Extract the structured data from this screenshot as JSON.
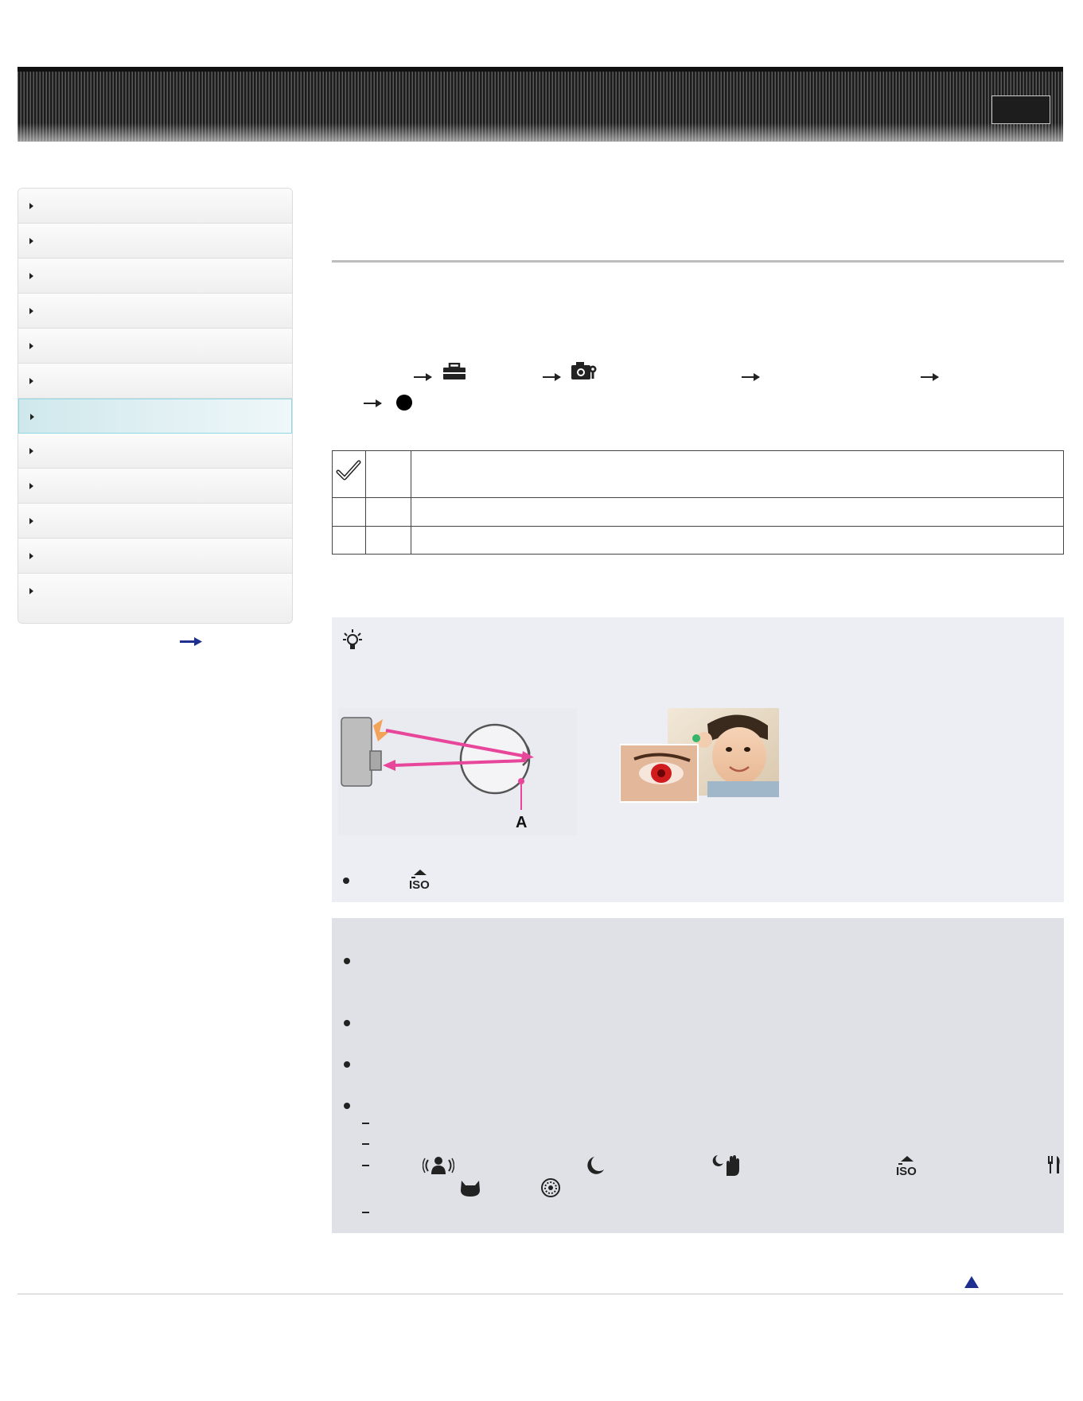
{
  "header": {
    "title": "",
    "top_button_label": ""
  },
  "sidebar": {
    "items": [
      {
        "label": ""
      },
      {
        "label": ""
      },
      {
        "label": ""
      },
      {
        "label": ""
      },
      {
        "label": ""
      },
      {
        "label": ""
      },
      {
        "label": "",
        "active": true
      },
      {
        "label": ""
      },
      {
        "label": ""
      },
      {
        "label": ""
      },
      {
        "label": ""
      },
      {
        "label": ""
      }
    ],
    "more_link_label": ""
  },
  "page": {
    "title": "",
    "intro": "",
    "menu_path_icons": [
      "toolbox-icon",
      "camera-settings-icon",
      "record-dot-icon"
    ]
  },
  "settings_table": {
    "rows": [
      {
        "icon": "checkmark-icon",
        "name": "",
        "description": ""
      },
      {
        "icon": "",
        "name": "",
        "description": ""
      },
      {
        "icon": "",
        "name": "",
        "description": ""
      }
    ]
  },
  "hint": {
    "icon": "lightbulb-icon",
    "title": "",
    "diagram_label": "A",
    "bullet_icon": "high-sensitivity-iso-icon"
  },
  "notes": {
    "title": "",
    "scene_icons": [
      "anti-blur-icon",
      "twilight-icon",
      "hand-held-twilight-icon",
      "high-sensitivity-iso-icon",
      "gourmet-icon",
      "pet-icon",
      "sports-icon"
    ]
  },
  "colors": {
    "header_dark": "#1c1c1c",
    "sidebar_active": "#cfe8ec",
    "sidebar_active_border": "#8fd9e6",
    "tip_bg": "#edeef3",
    "note_bg": "#e0e1e6",
    "diagram_arrow": "#e8469a",
    "back_to_top": "#1e2f8f"
  }
}
